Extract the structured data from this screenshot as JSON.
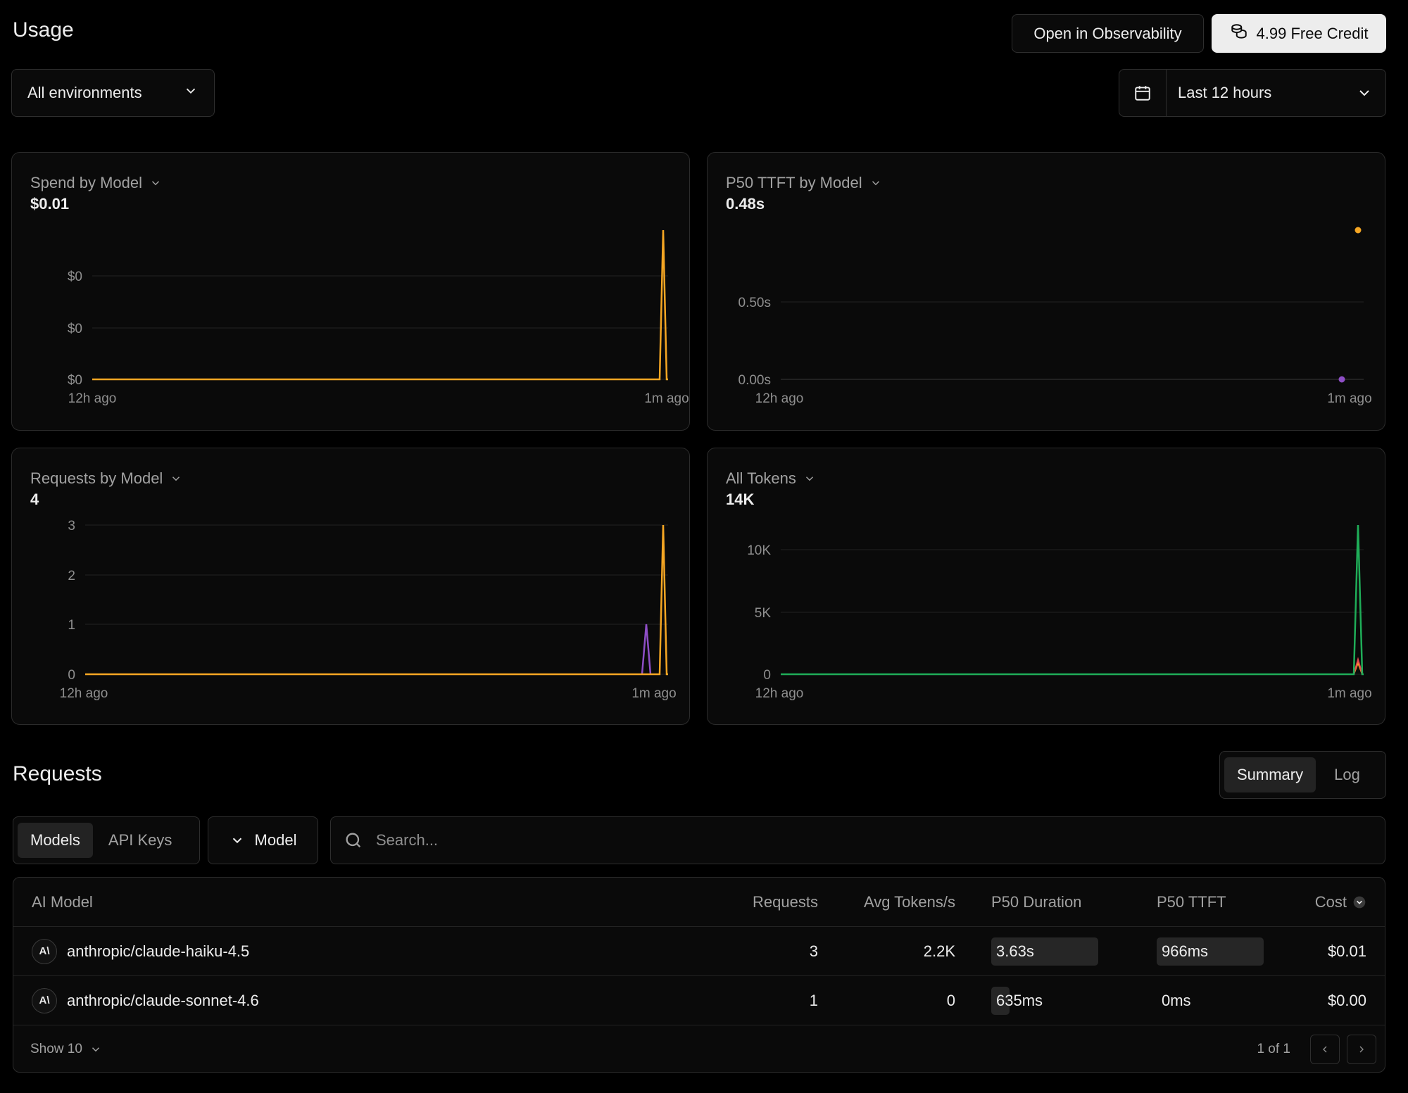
{
  "header": {
    "title": "Usage",
    "observability_label": "Open in Observability",
    "credit_label": "4.99 Free Credit"
  },
  "filters": {
    "environment": "All environments",
    "time_range": "Last 12 hours"
  },
  "colors": {
    "orange": "#f5a623",
    "purple": "#8e4ec6",
    "green": "#1fad58",
    "red": "#e5484d"
  },
  "cards": {
    "spend": {
      "title": "Spend by Model",
      "value": "$0.01",
      "yticks": [
        "$0",
        "$0",
        "$0"
      ],
      "xstart": "12h ago",
      "xend": "1m ago"
    },
    "ttft": {
      "title": "P50 TTFT by Model",
      "value": "0.48s",
      "yticks": [
        "0.50s",
        "0.00s"
      ],
      "xstart": "12h ago",
      "xend": "1m ago"
    },
    "requests": {
      "title": "Requests by Model",
      "value": "4",
      "yticks": [
        "3",
        "2",
        "1",
        "0"
      ],
      "xstart": "12h ago",
      "xend": "1m ago"
    },
    "tokens": {
      "title": "All Tokens",
      "value": "14K",
      "yticks": [
        "10K",
        "5K",
        "0"
      ],
      "xstart": "12h ago",
      "xend": "1m ago"
    }
  },
  "chart_data": [
    {
      "type": "line",
      "title": "Spend by Model",
      "yticks": [
        "$0",
        "$0",
        "$0"
      ],
      "x": [
        "12h ago",
        "1m ago"
      ],
      "series": [
        {
          "values_peak": 0.01,
          "peak_at": "near 1m ago",
          "color": "orange"
        }
      ]
    },
    {
      "type": "scatter",
      "title": "P50 TTFT by Model",
      "ylim": [
        0,
        0.5
      ],
      "yticks": [
        "0.50s",
        "0.00s"
      ],
      "x": [
        "12h ago",
        "1m ago"
      ],
      "series": [
        {
          "y": 0.98,
          "x": "1m ago",
          "color": "orange"
        },
        {
          "y": 0.0,
          "x": "near 1m ago",
          "color": "purple"
        }
      ]
    },
    {
      "type": "line",
      "title": "Requests by Model",
      "ylim": [
        0,
        3
      ],
      "yticks": [
        "3",
        "2",
        "1",
        "0"
      ],
      "x": [
        "12h ago",
        "1m ago"
      ],
      "series": [
        {
          "peak": 1,
          "color": "purple"
        },
        {
          "peak": 3,
          "color": "orange"
        }
      ]
    },
    {
      "type": "line",
      "title": "All Tokens",
      "ylim": [
        0,
        10000
      ],
      "yticks": [
        "10K",
        "5K",
        "0"
      ],
      "x": [
        "12h ago",
        "1m ago"
      ],
      "series": [
        {
          "peak": 12000,
          "color": "green"
        },
        {
          "peak": 1200,
          "color": "red"
        },
        {
          "peak": 800,
          "color": "orange"
        }
      ]
    }
  ],
  "requests": {
    "title": "Requests",
    "view_tabs": [
      "Summary",
      "Log"
    ],
    "group_tabs": [
      "Models",
      "API Keys"
    ],
    "model_filter": "Model",
    "search_placeholder": "Search...",
    "columns": {
      "model": "AI Model",
      "requests": "Requests",
      "avg_tokens": "Avg Tokens/s",
      "p50_duration": "P50 Duration",
      "p50_ttft": "P50 TTFT",
      "cost": "Cost"
    },
    "rows": [
      {
        "model": "anthropic/claude-haiku-4.5",
        "requests": "3",
        "avg_tokens": "2.2K",
        "p50_duration": "3.63s",
        "duration_fill": 1.0,
        "p50_ttft": "966ms",
        "ttft_fill": 1.0,
        "cost": "$0.01"
      },
      {
        "model": "anthropic/claude-sonnet-4.6",
        "requests": "1",
        "avg_tokens": "0",
        "p50_duration": "635ms",
        "duration_fill": 0.17,
        "p50_ttft": "0ms",
        "ttft_fill": 0.0,
        "cost": "$0.00"
      }
    ],
    "show_label": "Show 10",
    "page_label": "1 of 1"
  }
}
